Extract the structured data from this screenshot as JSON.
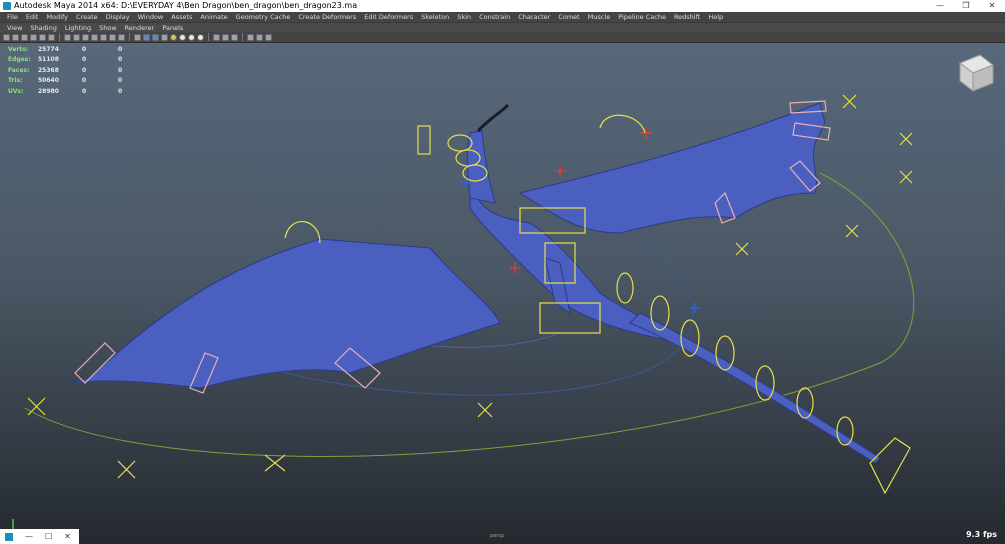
{
  "window": {
    "title": "Autodesk Maya 2014 x64: D:\\EVERYDAY 4\\Ben Dragon\\ben_dragon\\ben_dragon23.ma"
  },
  "menubar": [
    "File",
    "Edit",
    "Modify",
    "Create",
    "Display",
    "Window",
    "Assets",
    "Animate",
    "Geometry Cache",
    "Create Deformers",
    "Edit Deformers",
    "Skeleton",
    "Skin",
    "Constrain",
    "Character",
    "Comet",
    "Muscle",
    "Pipeline Cache",
    "Redshift",
    "Help"
  ],
  "panel_menu": [
    "View",
    "Shading",
    "Lighting",
    "Show",
    "Renderer",
    "Panels"
  ],
  "hud": {
    "rows": [
      {
        "label": "Verts:",
        "value": "25774",
        "c1": "0",
        "c2": "0"
      },
      {
        "label": "Edges:",
        "value": "51108",
        "c1": "0",
        "c2": "0"
      },
      {
        "label": "Faces:",
        "value": "25368",
        "c1": "0",
        "c2": "0"
      },
      {
        "label": "Tris:",
        "value": "50640",
        "c1": "0",
        "c2": "0"
      },
      {
        "label": "UVs:",
        "value": "28980",
        "c1": "0",
        "c2": "0"
      }
    ]
  },
  "viewport": {
    "fps": "9.3 fps",
    "camera_label": "persp"
  },
  "colors": {
    "dragon": "#4a5fc0",
    "rig_yellow": "#e6e14a",
    "rig_green": "#7ea33a",
    "rig_pink": "#e8b0b8",
    "rig_red": "#e23b3b"
  }
}
